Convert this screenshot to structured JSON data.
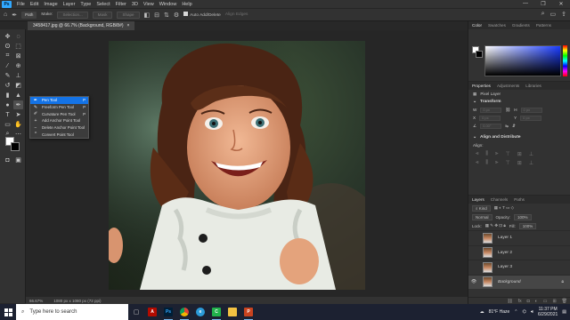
{
  "menubar": {
    "logo": "Ps",
    "items": [
      "File",
      "Edit",
      "Image",
      "Layer",
      "Type",
      "Select",
      "Filter",
      "3D",
      "View",
      "Window",
      "Help"
    ],
    "window_controls": [
      "—",
      "❐",
      "✕"
    ]
  },
  "options": {
    "mode_value": "Path",
    "make_label": "Make:",
    "selection_btn": "Selection...",
    "mask_btn": "Mask",
    "shape_btn": "Shape",
    "auto_add_delete": "Auto Add/Delete",
    "align_edges": "Align Edges"
  },
  "document": {
    "tab_title": "3458417.jpg @ 66.7% (Background, RGB/8#)",
    "close_glyph": "×"
  },
  "status": {
    "zoom": "66.67%",
    "doc_info": "1080 px x 1080 px (72 ppi)"
  },
  "flyout": {
    "items": [
      {
        "label": "Pen Tool",
        "shortcut": "P",
        "icon": "pen-icon"
      },
      {
        "label": "Freeform Pen Tool",
        "shortcut": "P",
        "icon": "freeform-pen-icon"
      },
      {
        "label": "Curvature Pen Tool",
        "shortcut": "P",
        "icon": "curvature-pen-icon"
      },
      {
        "label": "Add Anchor Point Tool",
        "shortcut": "",
        "icon": "add-anchor-icon"
      },
      {
        "label": "Delete Anchor Point Tool",
        "shortcut": "",
        "icon": "delete-anchor-icon"
      },
      {
        "label": "Convert Point Tool",
        "shortcut": "",
        "icon": "convert-point-icon"
      }
    ]
  },
  "panels": {
    "color_tabs": [
      "Color",
      "Swatches",
      "Gradients",
      "Patterns"
    ],
    "prop_tabs": [
      "Properties",
      "Adjustments",
      "Libraries"
    ],
    "prop_type": "Pixel Layer",
    "transform": "Transform",
    "w_label": "W",
    "h_label": "H",
    "x_label": "X",
    "y_label": "Y",
    "w_value": "0 px",
    "h_value": "0 px",
    "x_value": "0 px",
    "y_value": "0 px",
    "angle": "0.00°",
    "align": "Align and Distribute",
    "align_sub": "Align:",
    "layers_tabs": [
      "Layers",
      "Channels",
      "Paths"
    ]
  },
  "layers": {
    "kind": "Kind",
    "blend_mode": "Normal",
    "opacity_label": "Opacity:",
    "opacity": "100%",
    "lock_label": "Lock:",
    "fill_label": "Fill:",
    "fill": "100%",
    "items": [
      {
        "name": "Layer 1",
        "selected": false
      },
      {
        "name": "Layer 2",
        "selected": false
      },
      {
        "name": "Layer 3",
        "selected": false
      },
      {
        "name": "Background",
        "selected": true
      }
    ]
  },
  "taskbar": {
    "search_placeholder": "Type here to search",
    "weather": "81°F Haze",
    "time": "11:37 PM",
    "date": "6/29/2021",
    "apps": [
      {
        "name": "adobe-acrobat-icon",
        "glyph": "A",
        "color": "#b30b00"
      },
      {
        "name": "photoshop-icon",
        "glyph": "Ps",
        "color": "#31a8ff"
      },
      {
        "name": "chrome-icon",
        "glyph": "",
        "color": "#e8b30f"
      },
      {
        "name": "edge-icon",
        "glyph": "e",
        "color": "#2b9bd8"
      },
      {
        "name": "camtasia-icon",
        "glyph": "C",
        "color": "#21b24b"
      },
      {
        "name": "file-explorer-icon",
        "glyph": "▆",
        "color": "#f3c242"
      },
      {
        "name": "powerpoint-icon",
        "glyph": "P",
        "color": "#c8431f"
      }
    ]
  },
  "colors": {
    "accent": "#1473e6",
    "panel": "#323232",
    "canvas_bg": "#262626"
  }
}
